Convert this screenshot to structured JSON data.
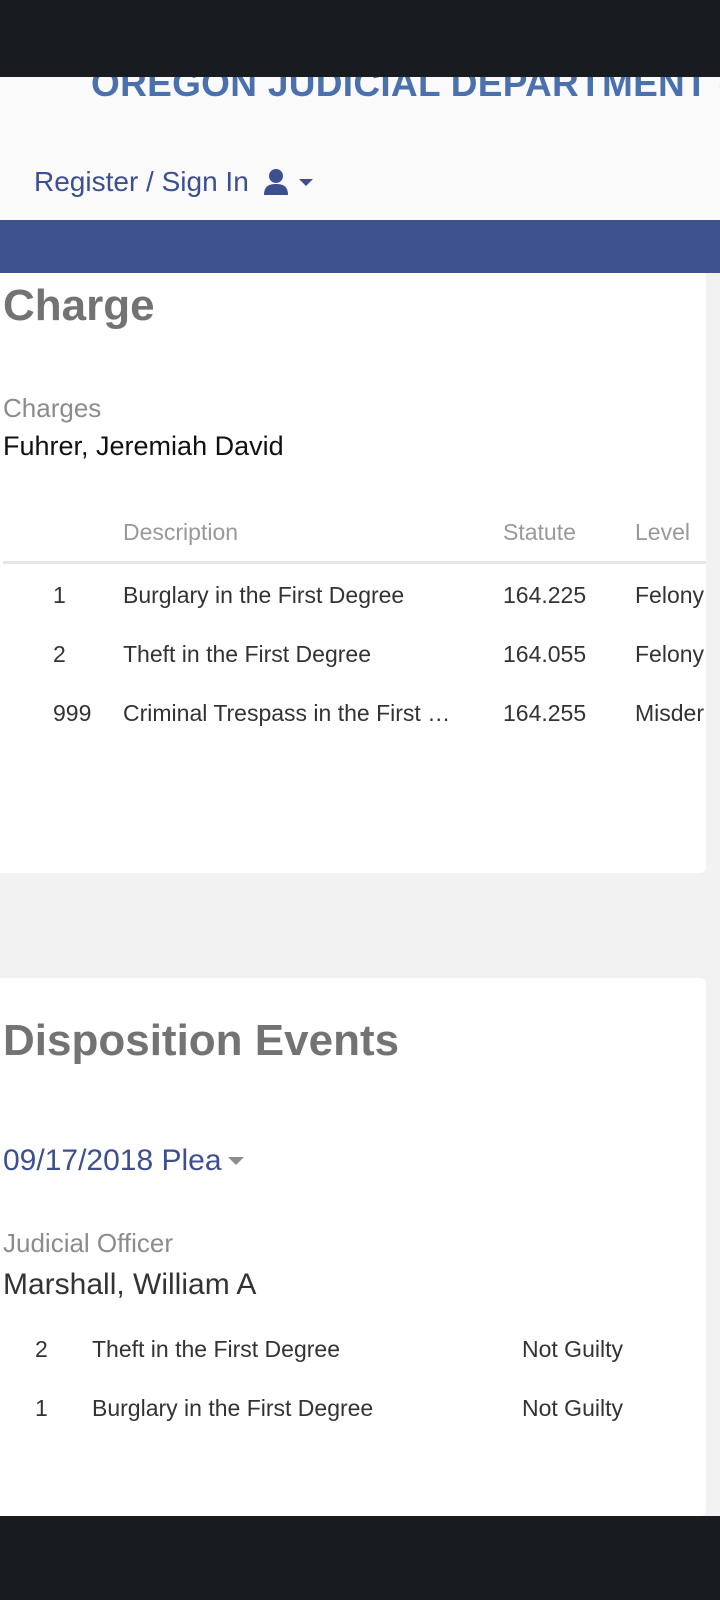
{
  "header": {
    "brand": "OREGON JUDICIAL DEPARTMENT -",
    "signin_label": "Register / Sign In"
  },
  "charge": {
    "title": "Charge",
    "charges_label": "Charges",
    "defendant": "Fuhrer, Jeremiah David",
    "columns": [
      "",
      "Description",
      "Statute",
      "Level"
    ],
    "rows": [
      {
        "num": "1",
        "description": "Burglary in the First Degree",
        "statute": "164.225",
        "level": "Felony"
      },
      {
        "num": "2",
        "description": "Theft in the First Degree",
        "statute": "164.055",
        "level": "Felony"
      },
      {
        "num": "999",
        "description": "Criminal Trespass in the First …",
        "statute": "164.255",
        "level": "Misder"
      }
    ]
  },
  "disposition": {
    "title": "Disposition Events",
    "event_link": "09/17/2018 Plea",
    "officer_label": "Judicial Officer",
    "officer_name": "Marshall, William A",
    "rows": [
      {
        "num": "2",
        "description": "Theft in the First Degree",
        "result": "Not Guilty"
      },
      {
        "num": "1",
        "description": "Burglary in the First Degree",
        "result": "Not Guilty"
      }
    ]
  },
  "icons": {
    "user": "user-icon",
    "caret": "caret-down-icon"
  },
  "colors": {
    "brand": "#4a71ad",
    "nav": "#3e5290",
    "link": "#3d4f8f"
  }
}
